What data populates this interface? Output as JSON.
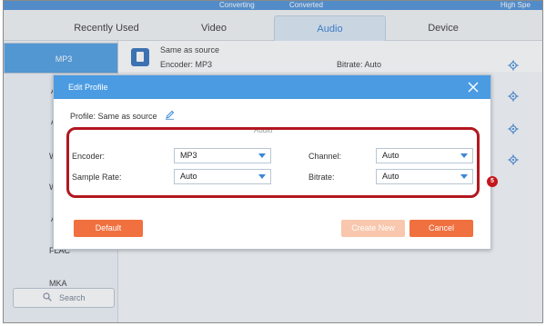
{
  "top_strip": {
    "left_text": "Converting",
    "right_text": "Converted",
    "far_right_text": "High Spe"
  },
  "tabs": [
    {
      "label": "Recently Used"
    },
    {
      "label": "Video"
    },
    {
      "label": "Audio"
    },
    {
      "label": "Device"
    }
  ],
  "formats": [
    {
      "label": "MP3"
    },
    {
      "label": "A"
    },
    {
      "label": "A"
    },
    {
      "label": "W"
    },
    {
      "label": "W"
    },
    {
      "label": "A"
    },
    {
      "label": "FLAC"
    },
    {
      "label": "MKA"
    }
  ],
  "search": {
    "label": "Search"
  },
  "preset_row": {
    "name": "Same as source",
    "encoder": "Encoder: MP3",
    "bitrate_label": "Bitrate:",
    "bitrate_value": "Auto"
  },
  "dialog": {
    "title": "Edit Profile",
    "profile_label": "Profile:",
    "profile_value": "Same as source",
    "section_label": "Audio",
    "fields": {
      "encoder": {
        "label": "Encoder:",
        "value": "MP3"
      },
      "channel": {
        "label": "Channel:",
        "value": "Auto"
      },
      "sample_rate": {
        "label": "Sample Rate:",
        "value": "Auto"
      },
      "bitrate": {
        "label": "Bitrate:",
        "value": "Auto"
      }
    },
    "buttons": {
      "default": "Default",
      "create_new": "Create New",
      "cancel": "Cancel"
    }
  },
  "annotation": {
    "step": "5",
    "color": "#b2171e"
  },
  "colors": {
    "accent": "#4a9be2",
    "orange": "#f0703f"
  }
}
